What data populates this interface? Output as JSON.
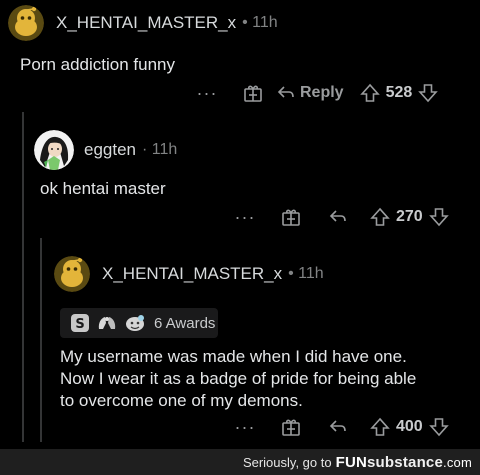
{
  "comments": [
    {
      "username": "X_HENTAI_MASTER_x",
      "time": "• 11h",
      "body": [
        "Porn addiction funny"
      ],
      "actions": {
        "more": "···",
        "reply": "Reply",
        "score": "528"
      },
      "avatar": "snoo-yellow-avatar"
    },
    {
      "username": "eggten",
      "time": "· 11h",
      "body": [
        "ok hentai master"
      ],
      "actions": {
        "more": "···",
        "score": "270"
      },
      "avatar": "anime-character-avatar"
    },
    {
      "username": "X_HENTAI_MASTER_x",
      "time": "• 11h",
      "awards": "6 Awards",
      "body": [
        "My username was made when I did have one.",
        "Now I wear it as a badge of pride for being able",
        "to overcome one of my demons."
      ],
      "actions": {
        "more": "···",
        "score": "400"
      },
      "avatar": "snoo-yellow-avatar"
    }
  ],
  "footer": {
    "text": "Seriously, go to",
    "logo_fun": "FUN",
    "logo_substance": "substance",
    "logo_com": ".com"
  },
  "colors": {
    "background": "#000000",
    "muted": "#818384",
    "text": "#d7dadc",
    "thread": "#343536"
  }
}
